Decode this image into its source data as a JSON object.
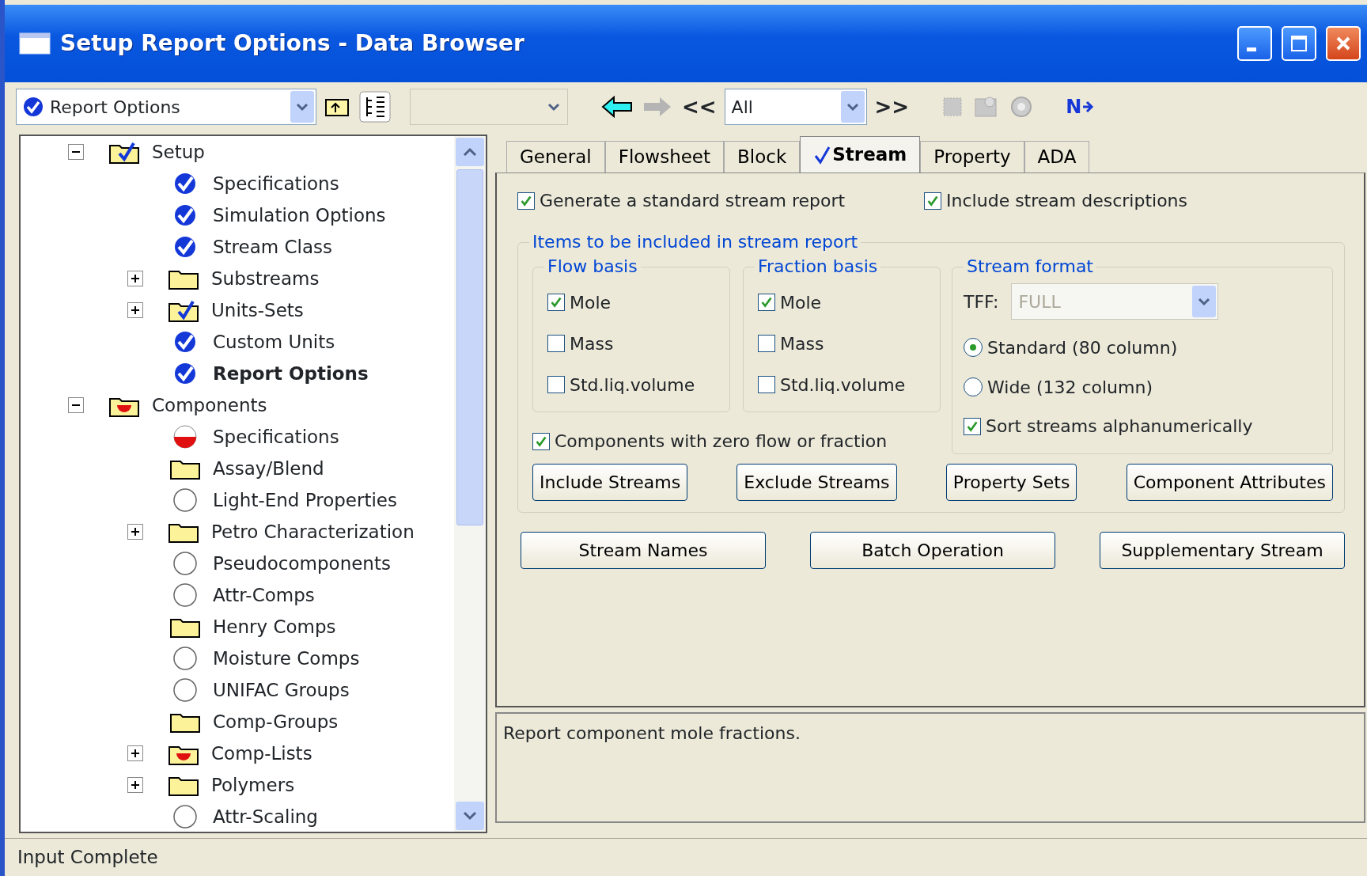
{
  "window": {
    "title": "Setup Report Options - Data Browser"
  },
  "toolbar": {
    "form_selector": {
      "value": "Report Options"
    },
    "section_selector": {
      "disabled": true
    },
    "back": {
      "disabled": false
    },
    "forward": {
      "disabled": true
    },
    "prev_label": "<<",
    "page_selector": {
      "value": "All"
    },
    "next_label": ">>",
    "next_incomplete_label": "N"
  },
  "tree": [
    {
      "label": "Setup",
      "kind": "folder-check",
      "expanded": true,
      "selected": false,
      "children": [
        {
          "label": "Specifications",
          "kind": "check",
          "selected": false
        },
        {
          "label": "Simulation Options",
          "kind": "check",
          "selected": false
        },
        {
          "label": "Stream Class",
          "kind": "check",
          "selected": false
        },
        {
          "label": "Substreams",
          "kind": "folder",
          "expanded": false,
          "selected": false
        },
        {
          "label": "Units-Sets",
          "kind": "folder-check",
          "expanded": false,
          "selected": false
        },
        {
          "label": "Custom Units",
          "kind": "check",
          "selected": false
        },
        {
          "label": "Report Options",
          "kind": "check",
          "selected": true
        }
      ]
    },
    {
      "label": "Components",
      "kind": "folder-red",
      "expanded": true,
      "selected": false,
      "children": [
        {
          "label": "Specifications",
          "kind": "red-half",
          "selected": false
        },
        {
          "label": "Assay/Blend",
          "kind": "folder",
          "selected": false
        },
        {
          "label": "Light-End Properties",
          "kind": "circle",
          "selected": false
        },
        {
          "label": "Petro Characterization",
          "kind": "folder",
          "expanded": false,
          "selected": false
        },
        {
          "label": "Pseudocomponents",
          "kind": "circle",
          "selected": false
        },
        {
          "label": "Attr-Comps",
          "kind": "circle",
          "selected": false
        },
        {
          "label": "Henry Comps",
          "kind": "folder",
          "selected": false
        },
        {
          "label": "Moisture Comps",
          "kind": "circle",
          "selected": false
        },
        {
          "label": "UNIFAC Groups",
          "kind": "circle",
          "selected": false
        },
        {
          "label": "Comp-Groups",
          "kind": "folder",
          "selected": false
        },
        {
          "label": "Comp-Lists",
          "kind": "folder-red",
          "expanded": false,
          "selected": false
        },
        {
          "label": "Polymers",
          "kind": "folder",
          "expanded": false,
          "selected": false
        },
        {
          "label": "Attr-Scaling",
          "kind": "circle",
          "selected": false
        }
      ]
    }
  ],
  "tabs": [
    {
      "label": "General",
      "selected": false,
      "complete": false
    },
    {
      "label": "Flowsheet",
      "selected": false,
      "complete": false
    },
    {
      "label": "Block",
      "selected": false,
      "complete": false
    },
    {
      "label": "Stream",
      "selected": true,
      "complete": true
    },
    {
      "label": "Property",
      "selected": false,
      "complete": false
    },
    {
      "label": "ADA",
      "selected": false,
      "complete": false
    }
  ],
  "stream_tab": {
    "top_checks": [
      {
        "label": "Generate a standard stream report",
        "checked": true
      },
      {
        "label": "Include stream descriptions",
        "checked": true
      }
    ],
    "items_group": {
      "legend": "Items to be included in stream report",
      "flow_basis": {
        "legend": "Flow basis",
        "options": [
          {
            "label": "Mole",
            "checked": true
          },
          {
            "label": "Mass",
            "checked": false
          },
          {
            "label": "Std.liq.volume",
            "checked": false
          }
        ]
      },
      "fraction_basis": {
        "legend": "Fraction basis",
        "options": [
          {
            "label": "Mole",
            "checked": true
          },
          {
            "label": "Mass",
            "checked": false
          },
          {
            "label": "Std.liq.volume",
            "checked": false
          }
        ]
      },
      "stream_format": {
        "legend": "Stream format",
        "tff_label": "TFF:",
        "tff_value": "FULL",
        "tff_disabled": true,
        "radios": [
          {
            "label": "Standard (80 column)",
            "selected": true
          },
          {
            "label": "Wide (132 column)",
            "selected": false
          }
        ],
        "sort": {
          "label": "Sort streams alphanumerically",
          "checked": true
        }
      },
      "zero_components": {
        "label": "Components with zero flow or fraction",
        "checked": true
      },
      "buttons": [
        "Include Streams",
        "Exclude Streams",
        "Property Sets",
        "Component Attributes"
      ]
    },
    "buttons": [
      "Stream Names",
      "Batch Operation",
      "Supplementary Stream"
    ]
  },
  "description": "Report component mole fractions.",
  "status_bar": "Input Complete"
}
